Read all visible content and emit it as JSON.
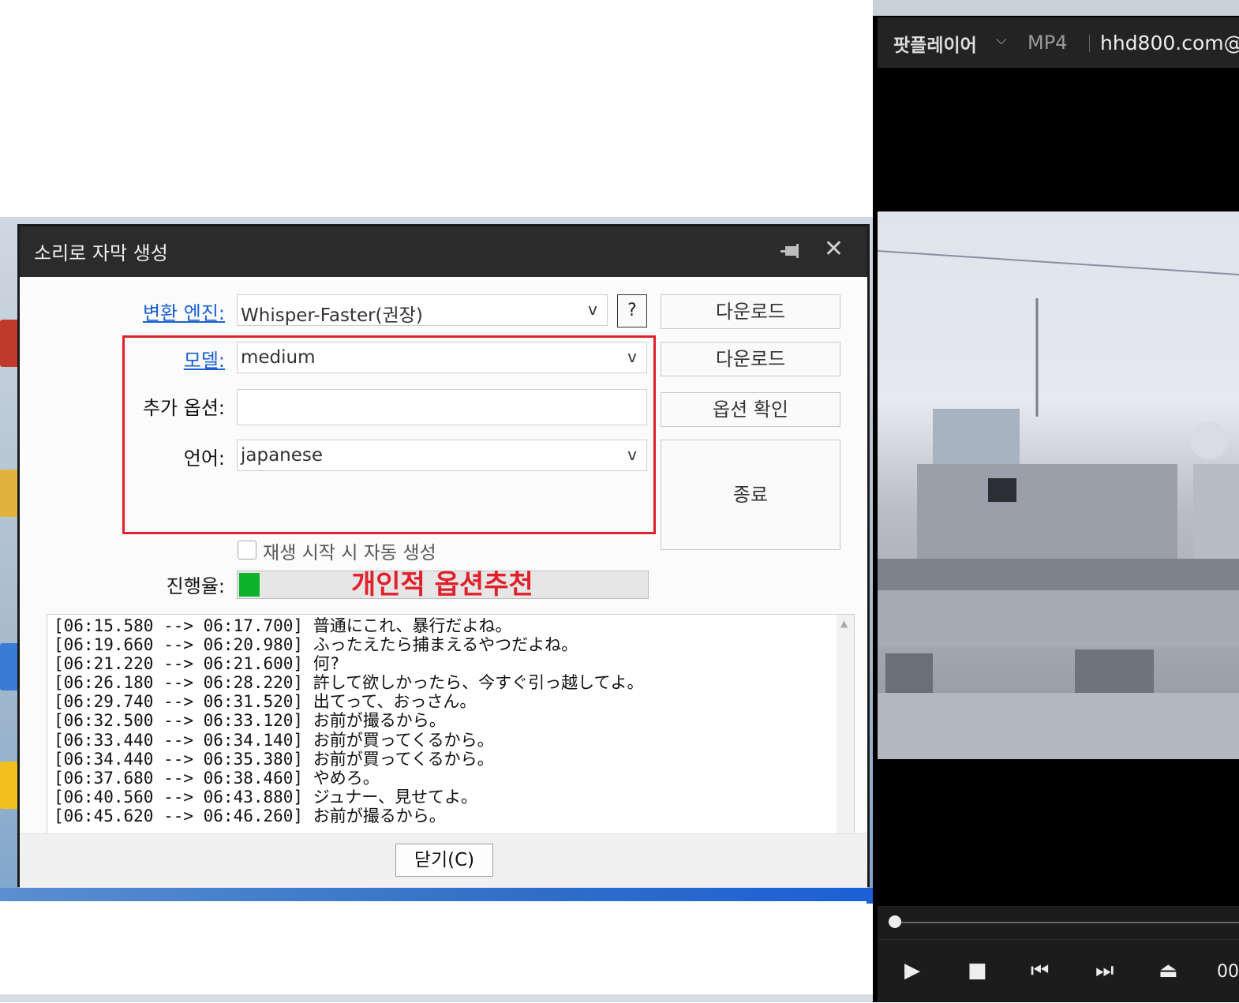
{
  "dialog": {
    "title": "소리로 자막 생성",
    "engine_label": "변환 엔진:",
    "engine_value": "Whisper-Faster(권장)",
    "help_label": "?",
    "model_label": "모델:",
    "model_value": "medium",
    "extra_label": "추가 옵션:",
    "extra_value": "",
    "language_label": "언어:",
    "language_value": "japanese",
    "dropdown_caret": "v",
    "download1": "다운로드",
    "download2": "다운로드",
    "option_check": "옵션 확인",
    "stop": "종료",
    "autostart_label": "재생 시작 시 자동 생성",
    "progress_label": "진행율:",
    "progress": 0.05,
    "annotation": "개인적 옵션추천",
    "log_lines": [
      "[06:15.580 --> 06:17.700] 普通にこれ、暴行だよね。",
      "[06:19.660 --> 06:20.980] ふったえたら捕まえるやつだよね。",
      "[06:21.220 --> 06:21.600] 何?",
      "[06:26.180 --> 06:28.220] 許して欲しかったら、今すぐ引っ越してよ。",
      "[06:29.740 --> 06:31.520] 出てって、おっさん。",
      "[06:32.500 --> 06:33.120] お前が撮るから。",
      "[06:33.440 --> 06:34.140] お前が買ってくるから。",
      "[06:34.440 --> 06:35.380] お前が買ってくるから。",
      "[06:37.680 --> 06:38.460] やめろ。",
      "[06:40.560 --> 06:43.880] ジュナー、見せてよ。",
      "[06:45.620 --> 06:46.260] お前が撮るから。"
    ],
    "close_label": "닫기(C)"
  },
  "player": {
    "brand": "팟플레이어",
    "format": "MP4",
    "url": "hhd800.com@",
    "time": "00"
  },
  "colors": {
    "annotation": "#e0202a",
    "progress_fill": "#0fb22b",
    "link": "#1a5fd0",
    "titlebar": "#2b2b2b"
  }
}
